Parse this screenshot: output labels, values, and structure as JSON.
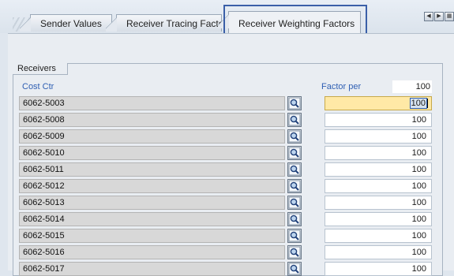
{
  "tabs": [
    {
      "label": "Sender Values"
    },
    {
      "label": "Receiver Tracing Factor"
    },
    {
      "label": "Receiver Weighting Factors",
      "active": true
    }
  ],
  "group": {
    "title": "Receivers"
  },
  "columns": {
    "cost_ctr": "Cost Ctr",
    "factor_per": "Factor per"
  },
  "factor_per_value": "100",
  "rows": [
    {
      "cost_ctr": "6062-5003",
      "factor": "100"
    },
    {
      "cost_ctr": "6062-5008",
      "factor": "100"
    },
    {
      "cost_ctr": "6062-5009",
      "factor": "100"
    },
    {
      "cost_ctr": "6062-5010",
      "factor": "100"
    },
    {
      "cost_ctr": "6062-5011",
      "factor": "100"
    },
    {
      "cost_ctr": "6062-5012",
      "factor": "100"
    },
    {
      "cost_ctr": "6062-5013",
      "factor": "100"
    },
    {
      "cost_ctr": "6062-5014",
      "factor": "100"
    },
    {
      "cost_ctr": "6062-5015",
      "factor": "100"
    },
    {
      "cost_ctr": "6062-5016",
      "factor": "100"
    },
    {
      "cost_ctr": "6062-5017",
      "factor": "100"
    }
  ],
  "icons": {
    "row_help": "search-help-icon",
    "scroll_left": "arrow-left-icon",
    "scroll_right": "arrow-right-icon",
    "tab_list": "tab-list-icon"
  },
  "colors": {
    "accent_outline": "#3a5fa8",
    "focused_field": "#ffe9a6",
    "column_header": "#2f5fb3"
  }
}
